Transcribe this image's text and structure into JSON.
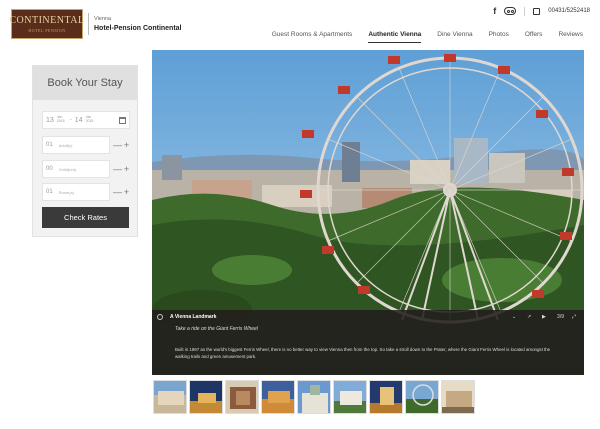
{
  "header": {
    "logo_text": "CONTINENTAL",
    "logo_sub": "HOTEL PENSION",
    "city": "Vienna",
    "hotel_name": "Hotel-Pension Continental",
    "social": {
      "facebook_icon": "facebook-icon",
      "tripadvisor_icon": "tripadvisor-icon",
      "phone_icon": "phone-icon"
    },
    "phone": "00431/5252418"
  },
  "nav": {
    "items": [
      {
        "label": "Guest Rooms & Apartments",
        "active": false
      },
      {
        "label": "Authentic Vienna",
        "active": true
      },
      {
        "label": "Dine Vienna",
        "active": false
      },
      {
        "label": "Photos",
        "active": false
      },
      {
        "label": "Offers",
        "active": false
      },
      {
        "label": "Reviews",
        "active": false
      }
    ]
  },
  "booking": {
    "title": "Book Your Stay",
    "arrival": {
      "day": "13",
      "month": "Jan",
      "year": "2015"
    },
    "departure": {
      "day": "14",
      "month": "Jan",
      "year": "2015"
    },
    "date_separator": "-",
    "adults": {
      "value": "01",
      "label": "Adult(s)"
    },
    "children": {
      "value": "00",
      "label": "Child(ren)"
    },
    "rooms": {
      "value": "01",
      "label": "Room(s)"
    },
    "minus": "—",
    "plus": "+",
    "button_label": "Check Rates"
  },
  "gallery": {
    "title": "A Vienna Landmark",
    "subtitle": "Take a ride on the Giant Ferris Wheel",
    "description": "Built in 1897 as the world's biggest Ferris Wheel, there is no better way to view Vienna then from the top. So take a stroll down to the Prater, where the Giant Ferris Wheel is located amongst the walking trails and green amusement park.",
    "counter": "3/9",
    "thumbnail_count": 9
  },
  "colors": {
    "accent": "#3a3a3a",
    "logo_bg": "#5a2c1a",
    "logo_gold": "#c8a46a",
    "caption_bg": "#221e1c"
  }
}
